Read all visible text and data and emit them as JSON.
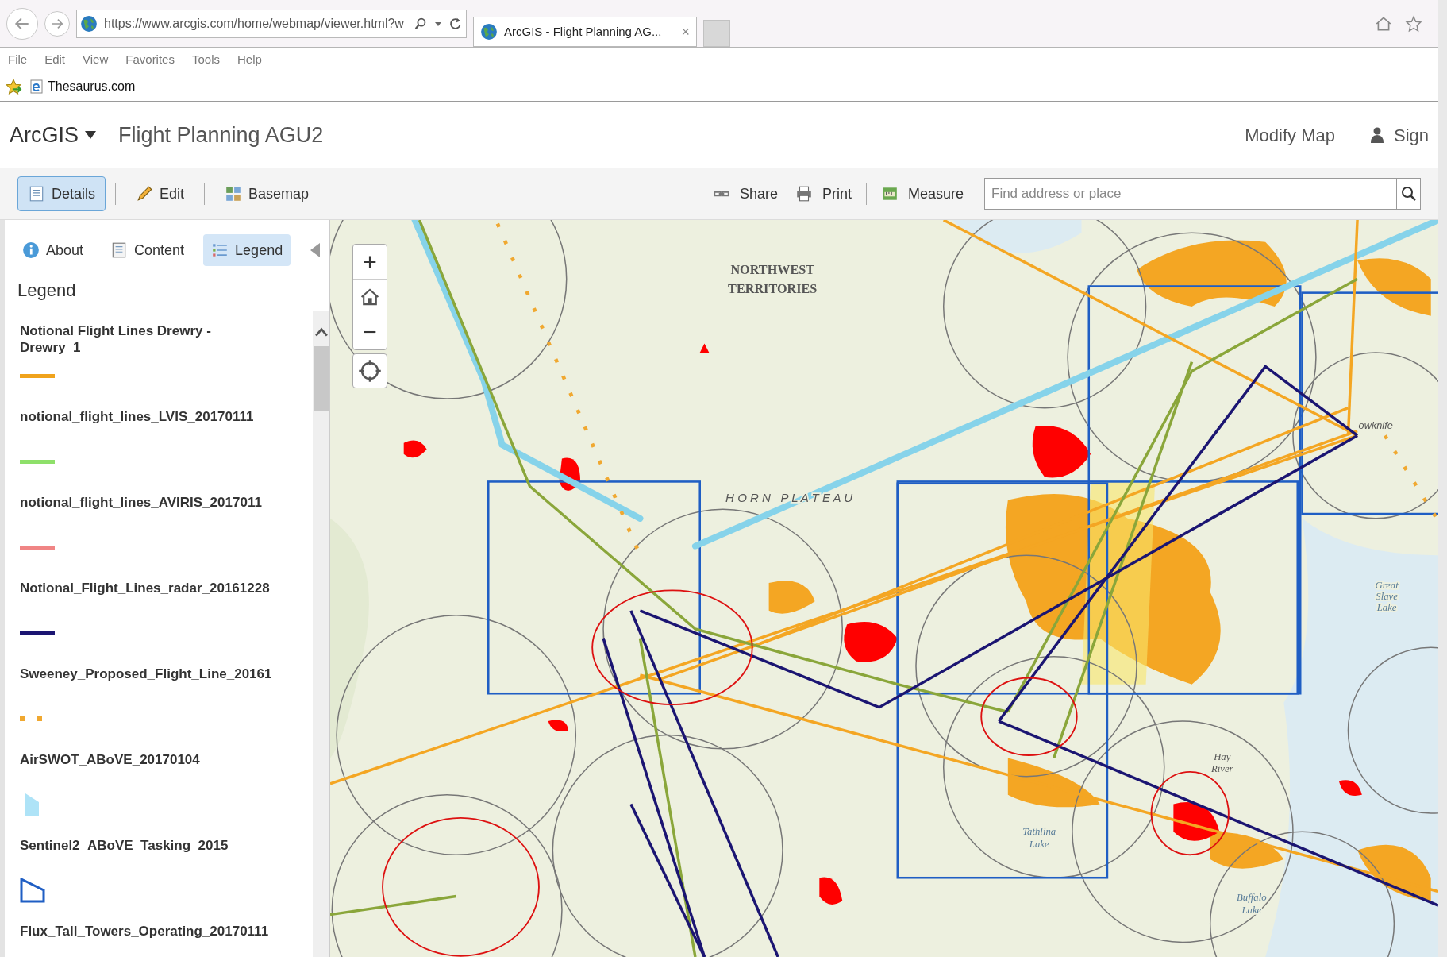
{
  "browser": {
    "address": "https://www.arcgis.com/home/webmap/viewer.html?w",
    "tab": {
      "title": "ArcGIS - Flight Planning AG...",
      "close": "×"
    },
    "menu": [
      "File",
      "Edit",
      "View",
      "Favorites",
      "Tools",
      "Help"
    ],
    "favorites": [
      "Thesaurus.com"
    ]
  },
  "header": {
    "brand": "ArcGIS",
    "title": "Flight Planning AGU2",
    "action": "Modify Map",
    "sign_in": "Sign"
  },
  "toolbar": {
    "left": [
      {
        "label": "Details",
        "selected": true
      },
      {
        "label": "Edit",
        "selected": false
      },
      {
        "label": "Basemap",
        "selected": false
      }
    ],
    "right": [
      "Share",
      "Print",
      "Measure"
    ],
    "search": {
      "placeholder": "Find address or place"
    }
  },
  "panel": {
    "tabs": [
      {
        "label": "About",
        "selected": false
      },
      {
        "label": "Content",
        "selected": false
      },
      {
        "label": "Legend",
        "selected": true
      }
    ],
    "heading": "Legend",
    "legend": [
      {
        "title": "Notional Flight Lines Drewry - Drewry_1",
        "kind": "line",
        "color": "#f0a31c"
      },
      {
        "title": "notional_flight_lines_LVIS_20170111",
        "kind": "line",
        "color": "#8ee06a"
      },
      {
        "title": "notional_flight_lines_AVIRIS_2017011",
        "kind": "line",
        "color": "#f08585"
      },
      {
        "title": "Notional_Flight_Lines_radar_20161228",
        "kind": "line",
        "color": "#1b1572"
      },
      {
        "title": "Sweeney_Proposed_Flight_Line_20161",
        "kind": "dots",
        "color": "#f0a830"
      },
      {
        "title": "AirSWOT_ABoVE_20170104",
        "kind": "fill",
        "color": "#aee3f7"
      },
      {
        "title": "Sentinel2_ABoVE_Tasking_2015",
        "kind": "outline",
        "color": "#1f5ec4"
      },
      {
        "title": "Flux_Tall_Towers_Operating_20170111"
      }
    ]
  },
  "map": {
    "zoom_in": "+",
    "zoom_out": "−",
    "labels": [
      "NORTHWEST",
      "TERRITORIES",
      "H O R N   P L A T E A U",
      "Great",
      "Slave",
      "Lake",
      "Hay",
      "River",
      "Tathlina",
      "Lake",
      "Buffalo",
      "Lake",
      "owknife"
    ]
  }
}
